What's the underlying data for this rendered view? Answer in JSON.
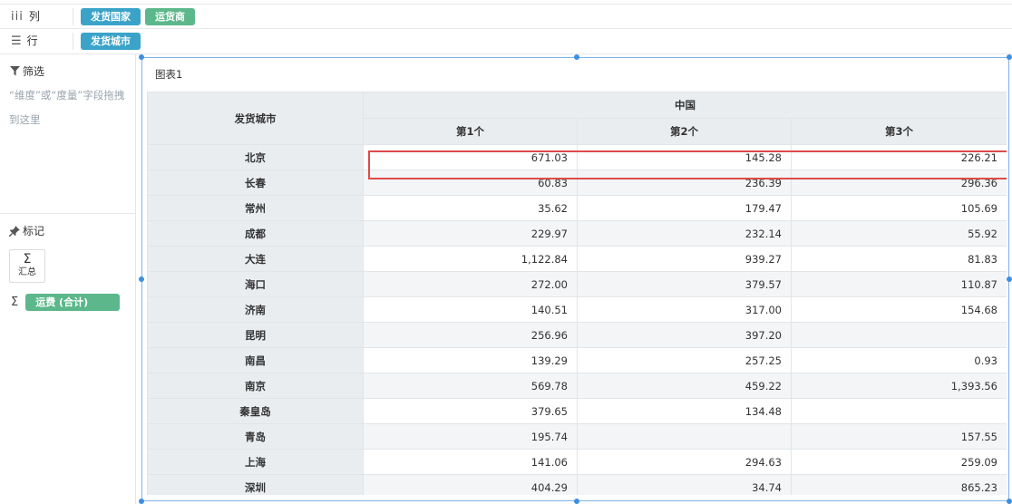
{
  "shelves": {
    "columns": {
      "label": "列",
      "pills": [
        "发货国家",
        "运货商"
      ]
    },
    "rows": {
      "label": "行",
      "pills": [
        "发货城市"
      ]
    }
  },
  "left_panel": {
    "filter_title": "筛选",
    "filter_hint": "“维度”或“度量”字段拖拽到这里",
    "mark_title": "标记",
    "sum_tile_label": "汇总",
    "measure_pill": "运费 (合计)"
  },
  "chart": {
    "title": "图表1",
    "header": {
      "row_header": "发货城市",
      "country": "中国",
      "carriers": [
        "第1个",
        "第2个",
        "第3个"
      ]
    },
    "rows": [
      {
        "city": "北京",
        "values": [
          "671.03",
          "145.28",
          "226.21"
        ]
      },
      {
        "city": "长春",
        "values": [
          "60.83",
          "236.39",
          "296.36"
        ]
      },
      {
        "city": "常州",
        "values": [
          "35.62",
          "179.47",
          "105.69"
        ]
      },
      {
        "city": "成都",
        "values": [
          "229.97",
          "232.14",
          "55.92"
        ]
      },
      {
        "city": "大连",
        "values": [
          "1,122.84",
          "939.27",
          "81.83"
        ]
      },
      {
        "city": "海口",
        "values": [
          "272.00",
          "379.57",
          "110.87"
        ]
      },
      {
        "city": "济南",
        "values": [
          "140.51",
          "317.00",
          "154.68"
        ]
      },
      {
        "city": "昆明",
        "values": [
          "256.96",
          "397.20",
          ""
        ]
      },
      {
        "city": "南昌",
        "values": [
          "139.29",
          "257.25",
          "0.93"
        ]
      },
      {
        "city": "南京",
        "values": [
          "569.78",
          "459.22",
          "1,393.56"
        ]
      },
      {
        "city": "秦皇岛",
        "values": [
          "379.65",
          "134.48",
          ""
        ]
      },
      {
        "city": "青岛",
        "values": [
          "195.74",
          "",
          "157.55"
        ]
      },
      {
        "city": "上海",
        "values": [
          "141.06",
          "294.63",
          "259.09"
        ]
      },
      {
        "city": "深圳",
        "values": [
          "404.29",
          "34.74",
          "865.23"
        ]
      }
    ]
  },
  "colors": {
    "dimension_pill": "#3ba3c8",
    "measure_pill": "#5cb88b",
    "highlight": "#e04a4a",
    "selection": "#3d8fe0"
  }
}
